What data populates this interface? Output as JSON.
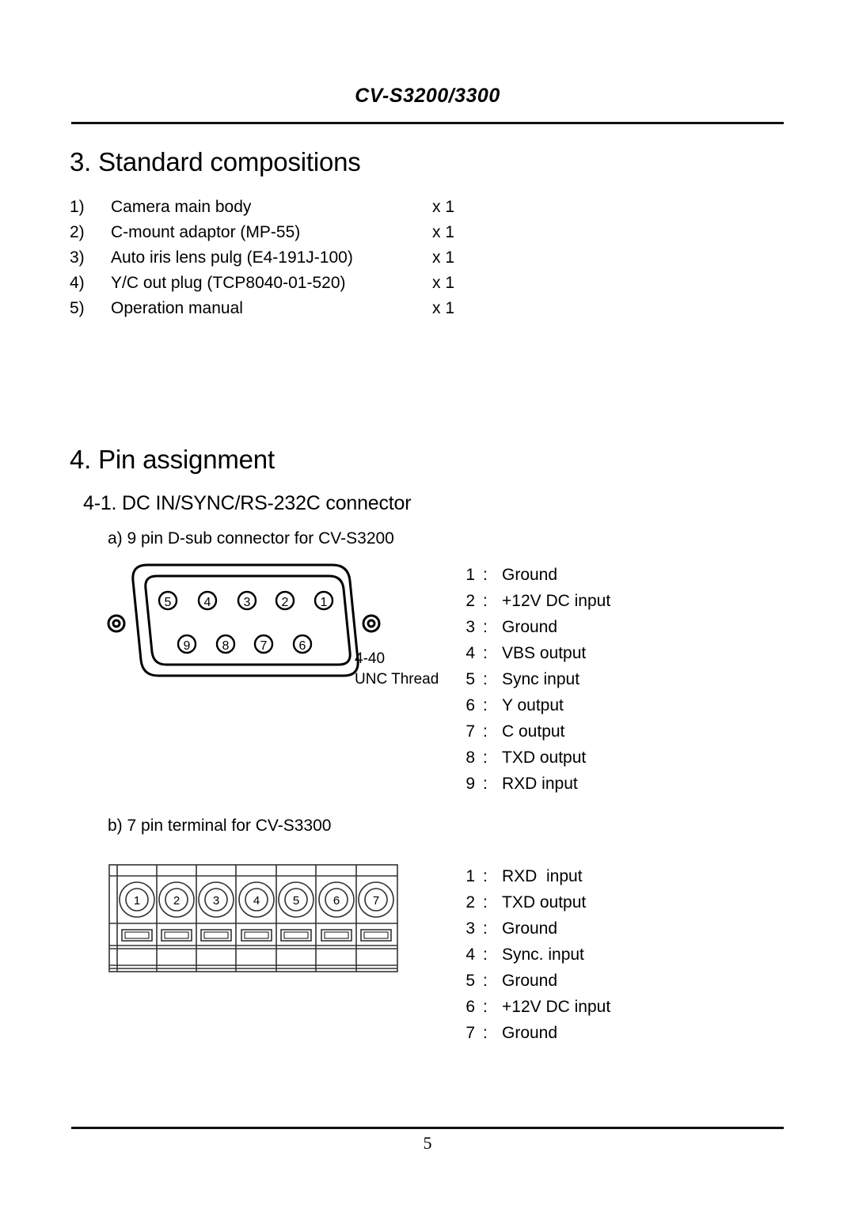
{
  "header": {
    "title": "CV-S3200/3300"
  },
  "footer": {
    "page_number": "5"
  },
  "sections": {
    "standard_compositions": {
      "heading": "3. Standard compositions",
      "items": [
        {
          "index": "1)",
          "name": "Camera main body",
          "qty": "x 1"
        },
        {
          "index": "2)",
          "name": "C-mount adaptor (MP-55)",
          "qty": "x 1"
        },
        {
          "index": "3)",
          "name": "Auto iris lens pulg (E4-191J-100)",
          "qty": "x 1"
        },
        {
          "index": "4)",
          "name": "Y/C out plug (TCP8040-01-520)",
          "qty": "x 1"
        },
        {
          "index": "5)",
          "name": "Operation manual",
          "qty": "x 1"
        }
      ]
    },
    "pin_assignment": {
      "heading": "4. Pin assignment",
      "subheading": "4-1. DC IN/SYNC/RS-232C connector",
      "dsub": {
        "caption": "a) 9 pin D-sub connector for CV-S3200",
        "thread_label_line1": "4-40",
        "thread_label_line2": "UNC Thread",
        "top_row_pins": [
          "5",
          "4",
          "3",
          "2",
          "1"
        ],
        "bottom_row_pins": [
          "9",
          "8",
          "7",
          "6"
        ],
        "pins": [
          {
            "num": "1",
            "colon": ":",
            "label": "Ground"
          },
          {
            "num": "2",
            "colon": ":",
            "label": "+12V DC input"
          },
          {
            "num": "3",
            "colon": ":",
            "label": "Ground"
          },
          {
            "num": "4",
            "colon": ":",
            "label": "VBS output"
          },
          {
            "num": "5",
            "colon": ":",
            "label": "Sync input"
          },
          {
            "num": "6",
            "colon": ":",
            "label": "Y output"
          },
          {
            "num": "7",
            "colon": ":",
            "label": "C output"
          },
          {
            "num": "8",
            "colon": ":",
            "label": "TXD output"
          },
          {
            "num": "9",
            "colon": ":",
            "label": "RXD input"
          }
        ]
      },
      "terminal": {
        "caption": "b) 7 pin terminal for CV-S3300",
        "screw_numbers": [
          "1",
          "2",
          "3",
          "4",
          "5",
          "6",
          "7"
        ],
        "pins": [
          {
            "num": "1",
            "colon": ":",
            "label": "RXD  input"
          },
          {
            "num": "2",
            "colon": ":",
            "label": "TXD output"
          },
          {
            "num": "3",
            "colon": ":",
            "label": "Ground"
          },
          {
            "num": "4",
            "colon": ":",
            "label": "Sync. input"
          },
          {
            "num": "5",
            "colon": ":",
            "label": "Ground"
          },
          {
            "num": "6",
            "colon": ":",
            "label": "+12V DC input"
          },
          {
            "num": "7",
            "colon": ":",
            "label": "Ground"
          }
        ]
      }
    }
  }
}
